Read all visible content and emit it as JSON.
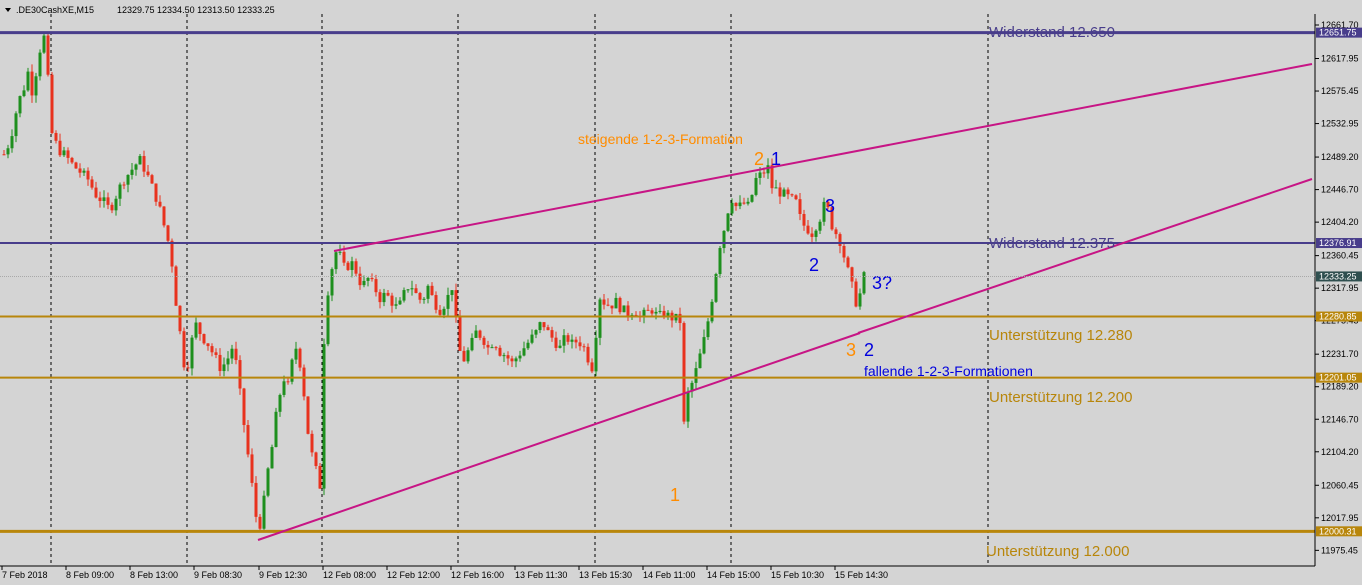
{
  "header": {
    "symbol": ".DE30CashXE,M15",
    "ohlc": "12329.75 12334.50 12313.50 12333.25",
    "menu_icon": "triangle-down-icon"
  },
  "colors": {
    "background": "#d4d4d4",
    "bull": "#1e8f1e",
    "bear": "#e8321e",
    "resistance": "#483d8b",
    "support": "#b8860b",
    "trendline": "#c71585",
    "orange_label": "#ff8c00",
    "blue_label": "#0000dd",
    "grid": "#000000"
  },
  "chart_data": {
    "type": "candlestick",
    "title": ".DE30CashXE,M15",
    "ylim": [
      11950,
      12695
    ],
    "y_ticks": [
      "12661.70",
      "12617.95",
      "12575.45",
      "12532.95",
      "12489.20",
      "12446.70",
      "12404.20",
      "12360.45",
      "12317.95",
      "12275.45",
      "12231.70",
      "12189.20",
      "12146.70",
      "12104.20",
      "12060.45",
      "12017.95",
      "11975.45"
    ],
    "x_ticks": [
      "7 Feb 2018",
      "8 Feb 09:00",
      "8 Feb 13:00",
      "9 Feb 08:30",
      "9 Feb 12:30",
      "12 Feb 08:00",
      "12 Feb 12:00",
      "12 Feb 16:00",
      "13 Feb 11:30",
      "13 Feb 15:30",
      "14 Feb 11:00",
      "14 Feb 15:00",
      "15 Feb 10:30",
      "15 Feb 14:30"
    ],
    "grid": true,
    "price_label": "12333.25",
    "level_labels": [
      {
        "value": "12651.75",
        "kind": "resistance"
      },
      {
        "value": "12376.91",
        "kind": "resistance"
      },
      {
        "value": "12280.85",
        "kind": "support"
      },
      {
        "value": "12201.05",
        "kind": "support"
      },
      {
        "value": "12000.31",
        "kind": "support"
      }
    ],
    "horizontal_levels": [
      {
        "label": "Widerstand 12.650",
        "price": 12651.75,
        "kind": "resistance"
      },
      {
        "label": "Widerstand 12.375",
        "price": 12376.91,
        "kind": "resistance"
      },
      {
        "label": "Unterstützung 12.280",
        "price": 12280.85,
        "kind": "support"
      },
      {
        "label": "Unterstützung 12.200",
        "price": 12201.05,
        "kind": "support"
      },
      {
        "label": "Unterstützung 12.000",
        "price": 12000.31,
        "kind": "support"
      }
    ],
    "annotations": {
      "rising_formation": "steigende 1-2-3-Formation",
      "falling_formations": "fallende 1-2-3-Formationen",
      "numbers": [
        {
          "text": "2",
          "color": "orange"
        },
        {
          "text": "1",
          "color": "blue"
        },
        {
          "text": "3",
          "color": "blue"
        },
        {
          "text": "2",
          "color": "blue"
        },
        {
          "text": "3?",
          "color": "blue"
        },
        {
          "text": "3",
          "color": "orange"
        },
        {
          "text": "2",
          "color": "blue"
        },
        {
          "text": "1",
          "color": "orange"
        }
      ]
    },
    "path": [
      [
        0,
        12480
      ],
      [
        3,
        12490
      ],
      [
        10,
        12510
      ],
      [
        18,
        12560
      ],
      [
        24,
        12580
      ],
      [
        28,
        12600
      ],
      [
        33,
        12570
      ],
      [
        38,
        12620
      ],
      [
        42,
        12640
      ],
      [
        46,
        12651
      ],
      [
        48,
        12590
      ],
      [
        52,
        12520
      ],
      [
        58,
        12500
      ],
      [
        66,
        12490
      ],
      [
        72,
        12480
      ],
      [
        80,
        12470
      ],
      [
        88,
        12460
      ],
      [
        96,
        12440
      ],
      [
        104,
        12430
      ],
      [
        110,
        12420
      ],
      [
        118,
        12445
      ],
      [
        124,
        12460
      ],
      [
        130,
        12470
      ],
      [
        136,
        12480
      ],
      [
        140,
        12485
      ],
      [
        146,
        12470
      ],
      [
        152,
        12450
      ],
      [
        158,
        12430
      ],
      [
        164,
        12400
      ],
      [
        168,
        12380
      ],
      [
        172,
        12350
      ],
      [
        176,
        12300
      ],
      [
        180,
        12260
      ],
      [
        183,
        12230
      ],
      [
        186,
        12200
      ],
      [
        190,
        12240
      ],
      [
        196,
        12270
      ],
      [
        202,
        12255
      ],
      [
        208,
        12245
      ],
      [
        214,
        12230
      ],
      [
        220,
        12215
      ],
      [
        226,
        12220
      ],
      [
        232,
        12240
      ],
      [
        236,
        12220
      ],
      [
        240,
        12180
      ],
      [
        244,
        12140
      ],
      [
        248,
        12100
      ],
      [
        252,
        12060
      ],
      [
        256,
        12020
      ],
      [
        260,
        12010
      ],
      [
        264,
        12040
      ],
      [
        268,
        12080
      ],
      [
        272,
        12110
      ],
      [
        276,
        12150
      ],
      [
        280,
        12180
      ],
      [
        284,
        12200
      ],
      [
        288,
        12190
      ],
      [
        292,
        12220
      ],
      [
        296,
        12240
      ],
      [
        300,
        12220
      ],
      [
        304,
        12180
      ],
      [
        308,
        12130
      ],
      [
        312,
        12100
      ],
      [
        316,
        12080
      ],
      [
        320,
        12060
      ],
      [
        322,
        12200
      ],
      [
        326,
        12300
      ],
      [
        330,
        12330
      ],
      [
        334,
        12360
      ],
      [
        338,
        12370
      ],
      [
        342,
        12350
      ],
      [
        346,
        12340
      ],
      [
        350,
        12355
      ],
      [
        356,
        12340
      ],
      [
        362,
        12320
      ],
      [
        368,
        12330
      ],
      [
        374,
        12320
      ],
      [
        380,
        12305
      ],
      [
        386,
        12310
      ],
      [
        392,
        12300
      ],
      [
        398,
        12290
      ],
      [
        404,
        12310
      ],
      [
        410,
        12325
      ],
      [
        416,
        12310
      ],
      [
        422,
        12300
      ],
      [
        428,
        12320
      ],
      [
        434,
        12300
      ],
      [
        440,
        12290
      ],
      [
        446,
        12300
      ],
      [
        452,
        12320
      ],
      [
        458,
        12250
      ],
      [
        462,
        12220
      ],
      [
        466,
        12230
      ],
      [
        470,
        12240
      ],
      [
        476,
        12260
      ],
      [
        482,
        12255
      ],
      [
        488,
        12240
      ],
      [
        494,
        12250
      ],
      [
        500,
        12235
      ],
      [
        506,
        12230
      ],
      [
        512,
        12220
      ],
      [
        518,
        12230
      ],
      [
        524,
        12240
      ],
      [
        530,
        12250
      ],
      [
        536,
        12260
      ],
      [
        542,
        12275
      ],
      [
        548,
        12260
      ],
      [
        554,
        12250
      ],
      [
        560,
        12240
      ],
      [
        566,
        12255
      ],
      [
        572,
        12245
      ],
      [
        578,
        12250
      ],
      [
        584,
        12240
      ],
      [
        590,
        12220
      ],
      [
        594,
        12210
      ],
      [
        598,
        12310
      ],
      [
        604,
        12300
      ],
      [
        610,
        12295
      ],
      [
        616,
        12300
      ],
      [
        622,
        12290
      ],
      [
        628,
        12285
      ],
      [
        634,
        12290
      ],
      [
        640,
        12280
      ],
      [
        646,
        12285
      ],
      [
        652,
        12290
      ],
      [
        658,
        12280
      ],
      [
        664,
        12285
      ],
      [
        670,
        12280
      ],
      [
        676,
        12278
      ],
      [
        680,
        12275
      ],
      [
        684,
        12140
      ],
      [
        688,
        12180
      ],
      [
        694,
        12200
      ],
      [
        700,
        12230
      ],
      [
        706,
        12260
      ],
      [
        710,
        12290
      ],
      [
        714,
        12320
      ],
      [
        718,
        12360
      ],
      [
        722,
        12390
      ],
      [
        726,
        12400
      ],
      [
        730,
        12440
      ],
      [
        734,
        12430
      ],
      [
        738,
        12420
      ],
      [
        742,
        12430
      ],
      [
        748,
        12425
      ],
      [
        752,
        12440
      ],
      [
        756,
        12460
      ],
      [
        760,
        12465
      ],
      [
        764,
        12470
      ],
      [
        768,
        12475
      ],
      [
        772,
        12450
      ],
      [
        778,
        12445
      ],
      [
        784,
        12440
      ],
      [
        790,
        12435
      ],
      [
        796,
        12430
      ],
      [
        800,
        12410
      ],
      [
        804,
        12400
      ],
      [
        808,
        12395
      ],
      [
        812,
        12390
      ],
      [
        816,
        12400
      ],
      [
        820,
        12410
      ],
      [
        824,
        12425
      ],
      [
        828,
        12420
      ],
      [
        832,
        12400
      ],
      [
        836,
        12390
      ],
      [
        840,
        12380
      ],
      [
        844,
        12360
      ],
      [
        848,
        12340
      ],
      [
        852,
        12320
      ],
      [
        856,
        12300
      ],
      [
        860,
        12310
      ],
      [
        864,
        12333
      ]
    ]
  }
}
